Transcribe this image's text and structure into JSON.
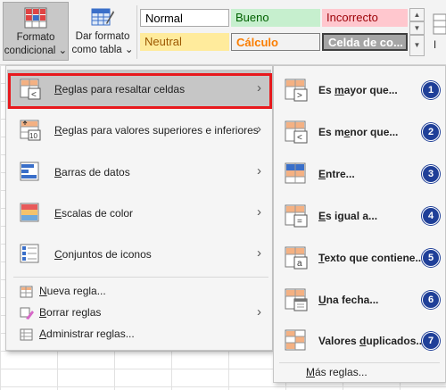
{
  "ribbon": {
    "formato_condicional": {
      "line1": "Formato",
      "line2": "condicional",
      "arrow": "⌄",
      "icon": "conditional-format-icon"
    },
    "dar_formato_tabla": {
      "line1": "Dar formato",
      "line2": "como tabla",
      "arrow": "⌄",
      "icon": "format-as-table-icon"
    },
    "styles": [
      {
        "label": "Normal"
      },
      {
        "label": "Bueno"
      },
      {
        "label": "Incorrecto"
      },
      {
        "label": "Neutral"
      },
      {
        "label": "Cálculo"
      },
      {
        "label": "Celda de co..."
      }
    ],
    "right_label": "I",
    "colors": {
      "bueno_bg": "#c6efce",
      "incorrecto_bg": "#ffc7ce",
      "neutral_bg": "#ffeb9c",
      "accent_red": "#e8191d",
      "badge_blue": "#1f3f98"
    }
  },
  "menu": {
    "items": [
      {
        "pre": "",
        "u": "R",
        "post": "eglas para resaltar celdas",
        "icon": "highlight-cells-rules-icon"
      },
      {
        "pre": "",
        "u": "R",
        "post": "eglas para valores superiores e inferiores",
        "icon": "top-bottom-rules-icon"
      },
      {
        "pre": "",
        "u": "B",
        "post": "arras de datos",
        "icon": "data-bars-icon"
      },
      {
        "pre": "",
        "u": "E",
        "post": "scalas de color",
        "icon": "color-scales-icon"
      },
      {
        "pre": "",
        "u": "C",
        "post": "onjuntos de iconos",
        "icon": "icon-sets-icon"
      }
    ],
    "small_items": [
      {
        "pre": "",
        "u": "N",
        "post": "ueva regla...",
        "icon": "new-rule-icon"
      },
      {
        "pre": "",
        "u": "B",
        "post": "orrar reglas",
        "icon": "clear-rules-icon"
      },
      {
        "pre": "",
        "u": "A",
        "post": "dministrar reglas...",
        "icon": "manage-rules-icon"
      }
    ],
    "arrow": "›"
  },
  "submenu": {
    "items": [
      {
        "pre": "Es ",
        "u": "m",
        "post": "ayor que...",
        "badge": "1"
      },
      {
        "pre": "Es m",
        "u": "e",
        "post": "nor que...",
        "badge": "2"
      },
      {
        "pre": "",
        "u": "E",
        "post": "ntre...",
        "badge": "3"
      },
      {
        "pre": "",
        "u": "E",
        "post": "s igual a...",
        "badge": "4"
      },
      {
        "pre": "",
        "u": "T",
        "post": "exto que contiene...",
        "badge": "5"
      },
      {
        "pre": "",
        "u": "U",
        "post": "na fecha...",
        "badge": "6"
      },
      {
        "pre": "Valores ",
        "u": "d",
        "post": "uplicados...",
        "badge": "7"
      }
    ],
    "more": {
      "pre": "",
      "u": "M",
      "post": "ás reglas..."
    }
  }
}
